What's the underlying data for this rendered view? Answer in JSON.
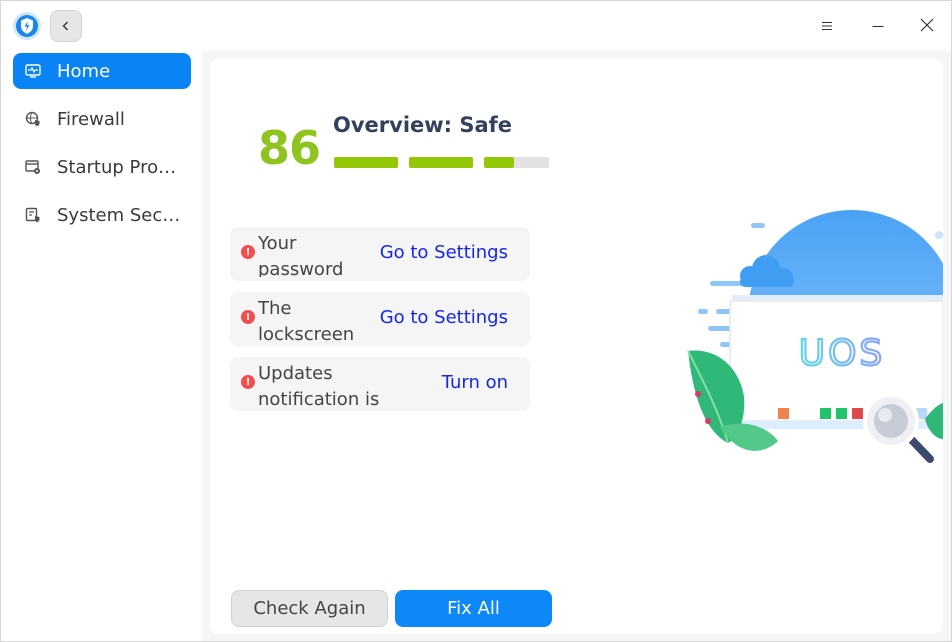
{
  "titlebar": {
    "logo_icon": "shield-lightning-icon",
    "back_icon": "chevron-left-icon",
    "menu_icon": "hamburger-menu-icon",
    "minimize_icon": "minimize-icon",
    "close_icon": "close-icon"
  },
  "sidebar": {
    "items": [
      {
        "label": "Home",
        "icon": "monitor-heartbeat-icon",
        "active": true
      },
      {
        "label": "Firewall",
        "icon": "globe-shield-icon",
        "active": false
      },
      {
        "label": "Startup Programs",
        "icon": "window-gear-icon",
        "active": false
      },
      {
        "label": "System Security",
        "icon": "document-shield-icon",
        "active": false
      }
    ]
  },
  "overview": {
    "score": "86",
    "title": "Overview: Safe",
    "progress": 0.82
  },
  "issues": [
    {
      "text": "Your password",
      "action": "Go to Settings"
    },
    {
      "text": "The lockscreen",
      "action": "Go to Settings"
    },
    {
      "text": "Updates notification is turned off",
      "action": "Turn on"
    }
  ],
  "warning_glyph": "!",
  "buttons": {
    "check_again": "Check Again",
    "fix_all": "Fix All"
  },
  "illustration": {
    "label": "UOS"
  },
  "colors": {
    "accent": "#0a84f5",
    "score_green": "#8fc31f",
    "bar_green": "#94c806",
    "link": "#1526e6",
    "warning": "#f14f4f"
  }
}
